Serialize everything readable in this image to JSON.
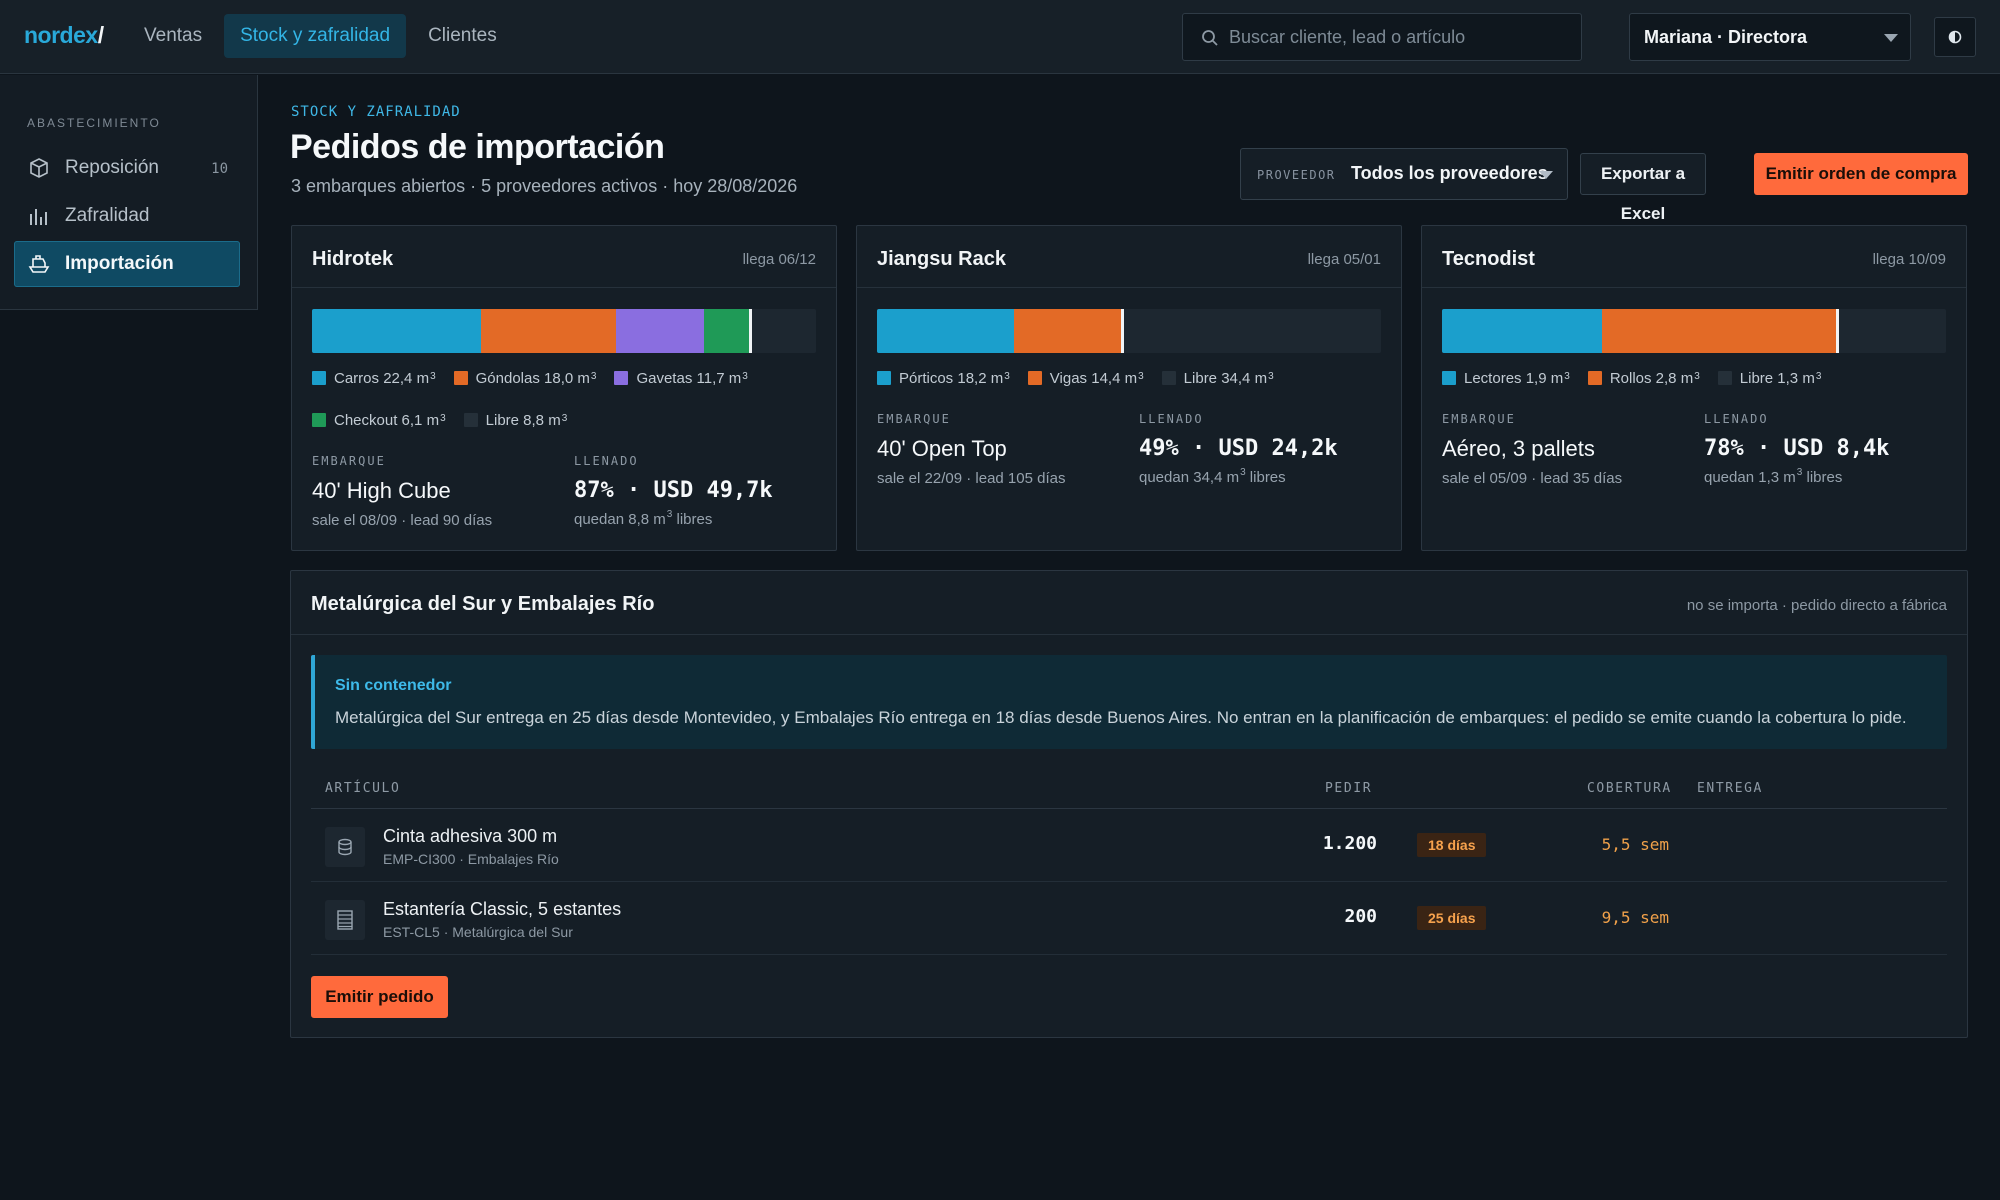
{
  "app": {
    "logo": "nordex",
    "logo_slash": "/"
  },
  "nav": {
    "tabs": [
      "Ventas",
      "Stock y zafralidad",
      "Clientes"
    ],
    "active": "Stock y zafralidad"
  },
  "search": {
    "placeholder": "Buscar cliente, lead o artículo",
    "value": ""
  },
  "user": {
    "label": "Mariana · Directora"
  },
  "sidebar": {
    "section": "ABASTECIMIENTO",
    "items": [
      {
        "label": "Reposición",
        "count": "10",
        "icon": "box-icon"
      },
      {
        "label": "Zafralidad",
        "count": "",
        "icon": "bar-chart-icon"
      },
      {
        "label": "Importación",
        "count": "",
        "icon": "ship-icon",
        "active": true
      }
    ]
  },
  "header": {
    "eyebrow": "STOCK Y ZAFRALIDAD",
    "title": "Pedidos de importación",
    "subtitle": "3 embarques abiertos · 5 proveedores activos · hoy 28/08/2026",
    "filter_label": "PROVEEDOR",
    "filter_value": "Todos los proveedores",
    "export_label": "Exportar a Excel",
    "emit_label": "Emitir orden de compra"
  },
  "colors": {
    "blue": "#1b9fcc",
    "orange": "#e36a26",
    "purple": "#8a6ee0",
    "green": "#1f9a57",
    "accent": "#ff6a3c"
  },
  "shipments": [
    {
      "supplier": "Hidrotek",
      "eta": "llega 06/12",
      "fill_pct": 87,
      "segments": [
        {
          "name": "Carros",
          "value": "22,4",
          "m3": 22.4,
          "color": "#1b9fcc"
        },
        {
          "name": "Góndolas",
          "value": "18,0",
          "m3": 18.0,
          "color": "#e36a26"
        },
        {
          "name": "Gavetas",
          "value": "11,7",
          "m3": 11.7,
          "color": "#8a6ee0"
        },
        {
          "name": "Checkout",
          "value": "6,1",
          "m3": 6.1,
          "color": "#1f9a57"
        }
      ],
      "free": {
        "name": "Libre",
        "value": "8,8",
        "m3": 8.8
      },
      "shipping_label": "EMBARQUE",
      "shipping": "40' High Cube",
      "departure": "sale el 08/09 · lead 90 días",
      "fill_label": "LLENADO",
      "fill_text": "87% · USD 49,7k",
      "remaining": "quedan 8,8 m",
      "remaining_suffix": " libres"
    },
    {
      "supplier": "Jiangsu Rack",
      "eta": "llega 05/01",
      "fill_pct": 49,
      "segments": [
        {
          "name": "Pórticos",
          "value": "18,2",
          "m3": 18.2,
          "color": "#1b9fcc"
        },
        {
          "name": "Vigas",
          "value": "14,4",
          "m3": 14.4,
          "color": "#e36a26"
        }
      ],
      "free": {
        "name": "Libre",
        "value": "34,4",
        "m3": 34.4
      },
      "shipping_label": "EMBARQUE",
      "shipping": "40' Open Top",
      "departure": "sale el 22/09 · lead 105 días",
      "fill_label": "LLENADO",
      "fill_text": "49% · USD 24,2k",
      "remaining": "quedan 34,4 m",
      "remaining_suffix": " libres"
    },
    {
      "supplier": "Tecnodist",
      "eta": "llega 10/09",
      "fill_pct": 78,
      "segments": [
        {
          "name": "Lectores",
          "value": "1,9",
          "m3": 1.9,
          "color": "#1b9fcc"
        },
        {
          "name": "Rollos",
          "value": "2,8",
          "m3": 2.8,
          "color": "#e36a26"
        }
      ],
      "free": {
        "name": "Libre",
        "value": "1,3",
        "m3": 1.3
      },
      "shipping_label": "EMBARQUE",
      "shipping": "Aéreo, 3 pallets",
      "departure": "sale el 05/09 · lead 35 días",
      "fill_label": "LLENADO",
      "fill_text": "78% · USD 8,4k",
      "remaining": "quedan 1,3 m",
      "remaining_suffix": " libres"
    }
  ],
  "unit": "m",
  "unit_exp": "3",
  "direct": {
    "title": "Metalúrgica del Sur y Embalajes Río",
    "note": "no se importa · pedido directo a fábrica",
    "callout_title": "Sin contenedor",
    "callout_text": "Metalúrgica del Sur entrega en 25 días desde Montevideo, y Embalajes Río entrega en 18 días desde Buenos Aires. No entran en la planificación de embarques: el pedido se emite cuando la cobertura lo pide.",
    "columns": [
      "ARTÍCULO",
      "PEDIR",
      "COBERTURA",
      "ENTREGA"
    ],
    "rows": [
      {
        "name": "Cinta adhesiva 300 m",
        "sub": "EMP-CI300 · Embalajes Río",
        "qty": "1.200",
        "coverage": "5,5 sem",
        "delivery": "18 días",
        "icon": "tape-roll-icon"
      },
      {
        "name": "Estantería Classic, 5 estantes",
        "sub": "EST-CL5 · Metalúrgica del Sur",
        "qty": "200",
        "coverage": "9,5 sem",
        "delivery": "25 días",
        "icon": "shelf-icon"
      }
    ],
    "button": "Emitir pedido"
  }
}
